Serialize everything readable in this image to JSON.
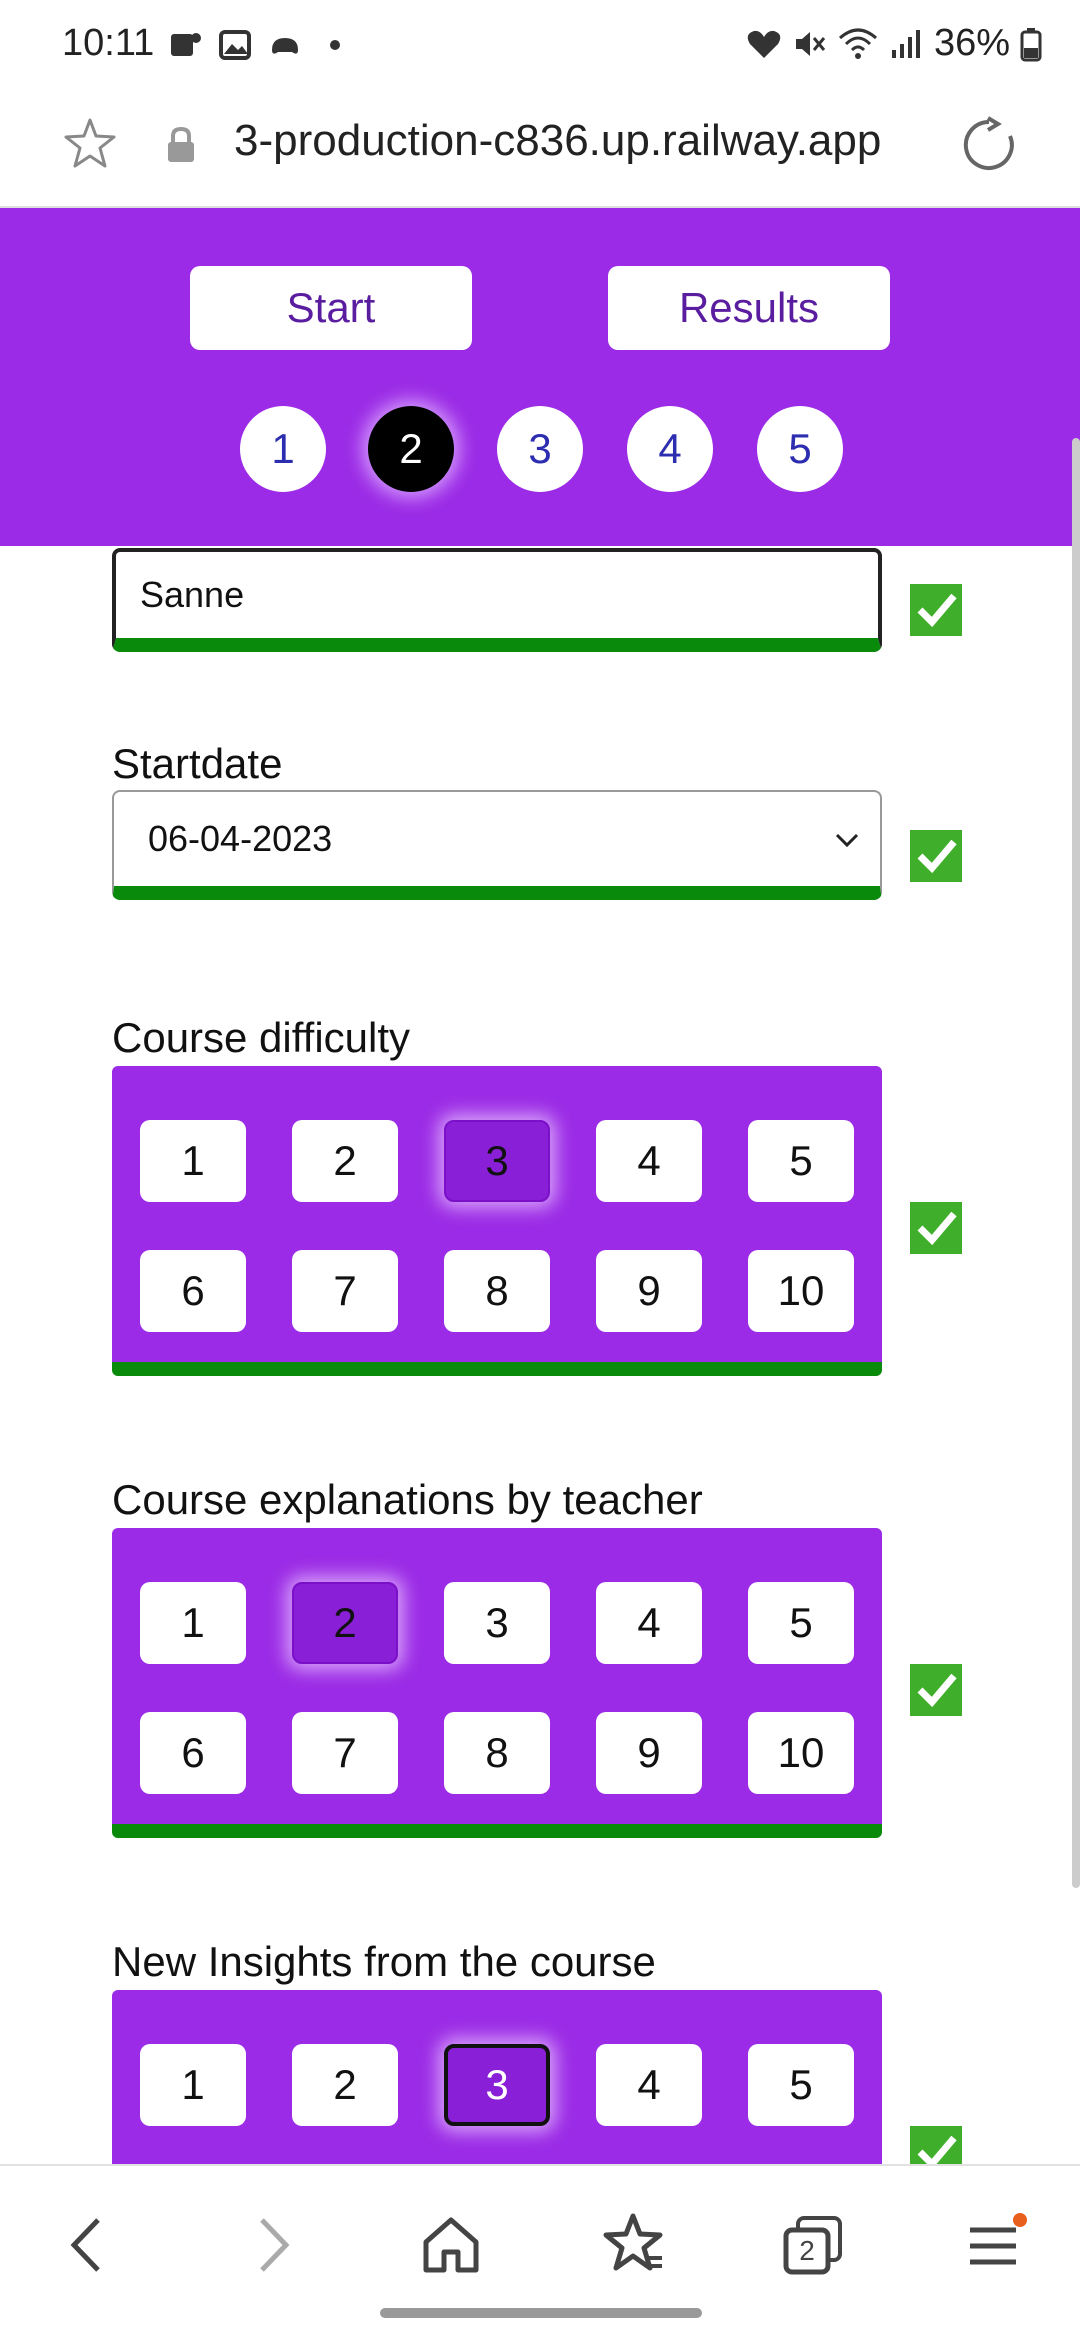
{
  "status_bar": {
    "time": "10:11",
    "battery": "36%"
  },
  "browser": {
    "url": "3-production-c836.up.railway.app",
    "tab_count": "2"
  },
  "header": {
    "start_label": "Start",
    "results_label": "Results",
    "steps": [
      "1",
      "2",
      "3",
      "4",
      "5"
    ],
    "active_step": "2"
  },
  "form": {
    "name_value": "Sanne",
    "startdate_label": "Startdate",
    "startdate_value": "06-04-2023",
    "groups": [
      {
        "label": "Course difficulty",
        "options": [
          "1",
          "2",
          "3",
          "4",
          "5",
          "6",
          "7",
          "8",
          "9",
          "10"
        ],
        "selected": "3"
      },
      {
        "label": "Course explanations by teacher",
        "options": [
          "1",
          "2",
          "3",
          "4",
          "5",
          "6",
          "7",
          "8",
          "9",
          "10"
        ],
        "selected": "2"
      },
      {
        "label": "New Insights from the course",
        "options": [
          "1",
          "2",
          "3",
          "4",
          "5"
        ],
        "selected": "3"
      }
    ]
  },
  "colors": {
    "accent_purple": "#9b2be6",
    "valid_green": "#0a8a0a",
    "selected_purple": "#8a1fd8"
  }
}
